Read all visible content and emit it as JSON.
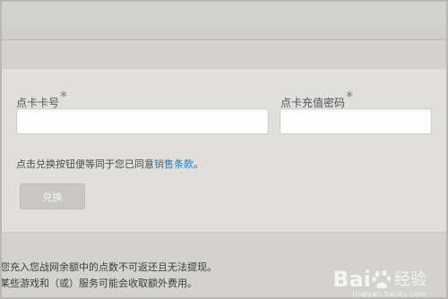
{
  "form": {
    "card_number_label": "点卡卡号",
    "card_pin_label": "点卡充值密码",
    "required_mark": "*",
    "card_number_value": "",
    "card_pin_value": "",
    "agree_prefix": "点击兑换按钮便等同于您已同意",
    "agree_link": "销售条款",
    "agree_suffix": "。",
    "redeem_button": "兑换"
  },
  "notice": {
    "line1": "您充入您战网余额中的点数不可返还且无法提现。",
    "line2": "某些游戏和（或）服务可能会收取额外费用。"
  },
  "watermark": {
    "logo_left": "Bai",
    "logo_right": "经验",
    "site": "jingyan.baidu.com"
  },
  "icons": {
    "watermark_paw": "paw-icon"
  }
}
